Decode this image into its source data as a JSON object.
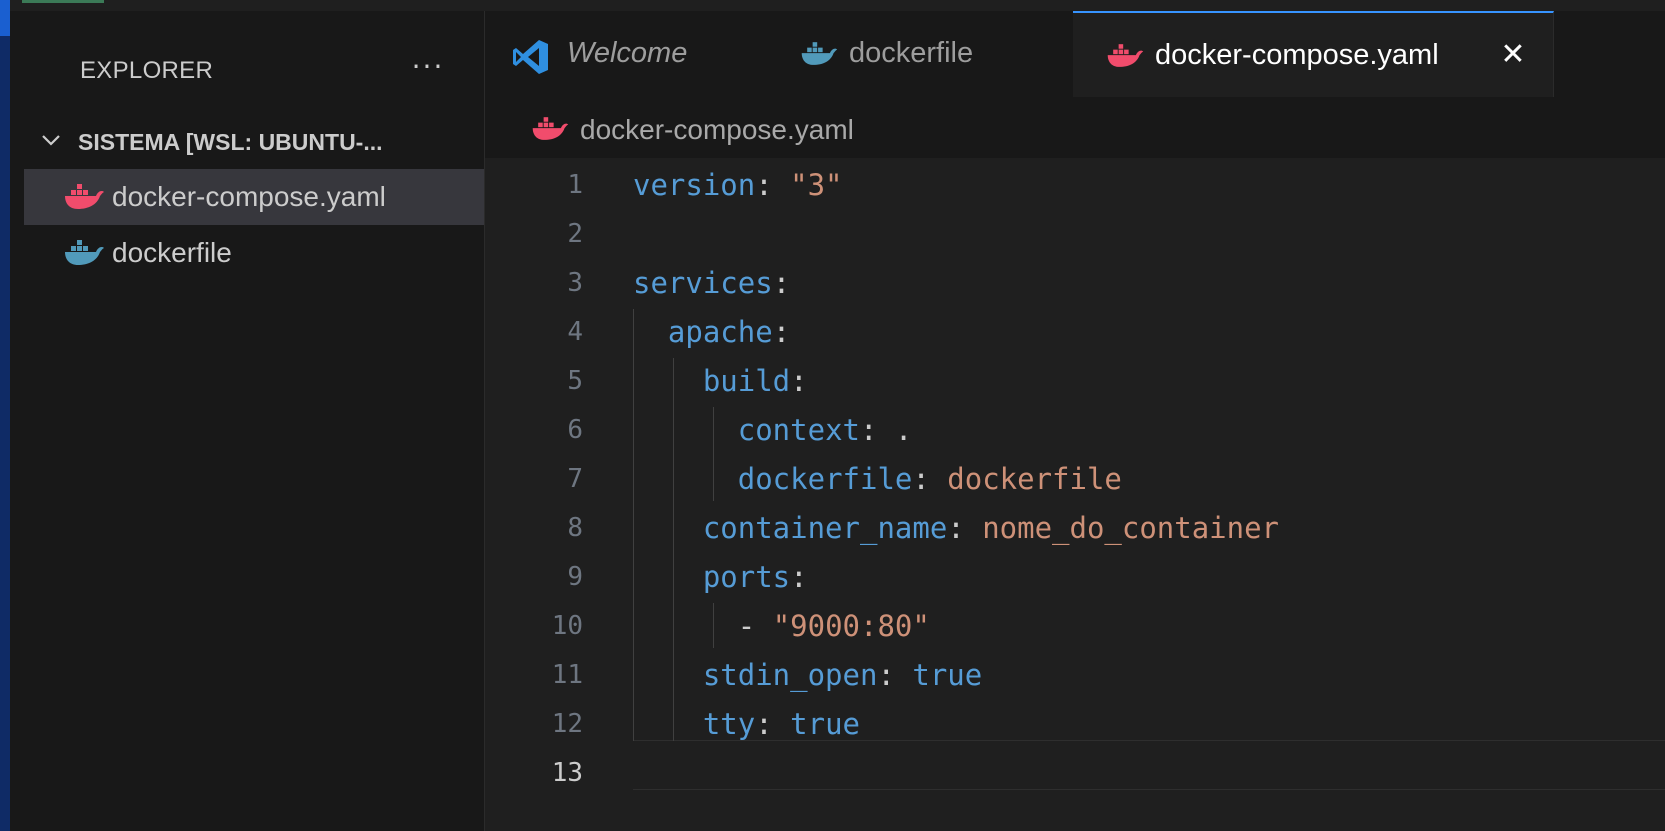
{
  "sidebar": {
    "title": "EXPLORER",
    "more_label": "···",
    "folder_label": "SISTEMA [WSL: UBUNTU-...",
    "files": [
      {
        "name": "docker-compose.yaml",
        "icon": "docker-icon",
        "color": "#f14c6c",
        "active": true
      },
      {
        "name": "dockerfile",
        "icon": "docker-icon",
        "color": "#519aba",
        "active": false
      }
    ]
  },
  "tabs": [
    {
      "label": "Welcome",
      "icon": "vscode-icon",
      "active": false
    },
    {
      "label": "dockerfile",
      "icon": "docker-icon",
      "active": false
    },
    {
      "label": "docker-compose.yaml",
      "icon": "docker-icon",
      "active": true,
      "close": "✕"
    }
  ],
  "breadcrumb": {
    "file": "docker-compose.yaml"
  },
  "editor": {
    "current_line": 13,
    "lines": [
      {
        "n": "1",
        "key": "version",
        "sep": ": ",
        "value": "\"3\"",
        "value_type": "string"
      },
      {
        "n": "2"
      },
      {
        "n": "3",
        "key": "services",
        "sep": ":"
      },
      {
        "n": "4",
        "indent": "  ",
        "key": "apache",
        "sep": ":"
      },
      {
        "n": "5",
        "indent": "    ",
        "key": "build",
        "sep": ":"
      },
      {
        "n": "6",
        "indent": "      ",
        "key": "context",
        "sep": ": ",
        "value": ".",
        "value_type": "punct"
      },
      {
        "n": "7",
        "indent": "      ",
        "key": "dockerfile",
        "sep": ": ",
        "value": "dockerfile",
        "value_type": "string"
      },
      {
        "n": "8",
        "indent": "    ",
        "key": "container_name",
        "sep": ": ",
        "value": "nome_do_container",
        "value_type": "string"
      },
      {
        "n": "9",
        "indent": "    ",
        "key": "ports",
        "sep": ":"
      },
      {
        "n": "10",
        "indent": "      ",
        "dash": "- ",
        "value": "\"9000:80\"",
        "value_type": "string"
      },
      {
        "n": "11",
        "indent": "    ",
        "key": "stdin_open",
        "sep": ": ",
        "value": "true",
        "value_type": "bool"
      },
      {
        "n": "12",
        "indent": "    ",
        "key": "tty",
        "sep": ": ",
        "value": "true",
        "value_type": "bool"
      },
      {
        "n": "13"
      }
    ]
  },
  "colors": {
    "accent": "#3794ff",
    "docker_compose_icon": "#f14c6c",
    "dockerfile_icon": "#519aba",
    "vscode_icon": "#2f8fe0"
  }
}
